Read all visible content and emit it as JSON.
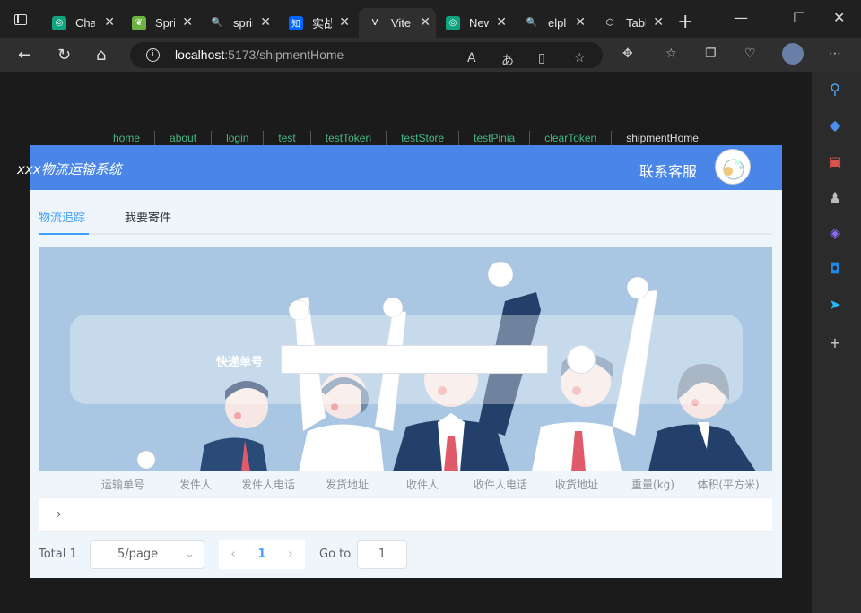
{
  "browser": {
    "tabs": [
      {
        "label": "Chat",
        "icon": "chatgpt-icon",
        "color": "#10a37f",
        "glyph": "◎"
      },
      {
        "label": "Sprin",
        "icon": "spring-leaf-icon",
        "color": "#6db33f",
        "glyph": "❦"
      },
      {
        "label": "spring",
        "icon": "search-icon",
        "color": "#202020",
        "glyph": "🔍"
      },
      {
        "label": "实战",
        "icon": "zhihu-icon",
        "color": "#0066ff",
        "glyph": "知"
      },
      {
        "label": "Vite",
        "icon": "vue-icon",
        "color": "#2f2f2f",
        "glyph": "V"
      },
      {
        "label": "New",
        "icon": "chatgpt-icon",
        "color": "#10a37f",
        "glyph": "◎"
      },
      {
        "label": "elpl",
        "icon": "search-icon",
        "color": "#202020",
        "glyph": "🔍"
      },
      {
        "label": "Tabl",
        "icon": "element-icon",
        "color": "#202020",
        "glyph": "⬡"
      }
    ],
    "url_host": "localhost",
    "url_path": ":5173/shipmentHome"
  },
  "topnav": [
    "home",
    "about",
    "login",
    "test",
    "testToken",
    "testStore",
    "testPinia",
    "clearToken",
    "shipmentHome"
  ],
  "header": {
    "brand": "xxx物流运输系统",
    "contact": "联系客服"
  },
  "tabs": [
    "物流追踪",
    "我要寄件"
  ],
  "search": {
    "label": "快递单号",
    "value": ""
  },
  "table": {
    "columns": [
      "运输单号",
      "发件人",
      "发件人电话",
      "发货地址",
      "收件人",
      "收件人电话",
      "收货地址",
      "重量(kg)",
      "体积(平方米)"
    ]
  },
  "pagination": {
    "total": "Total 1",
    "page_size": "5/page",
    "current_page": "1",
    "goto_label": "Go to",
    "goto_value": "1"
  }
}
